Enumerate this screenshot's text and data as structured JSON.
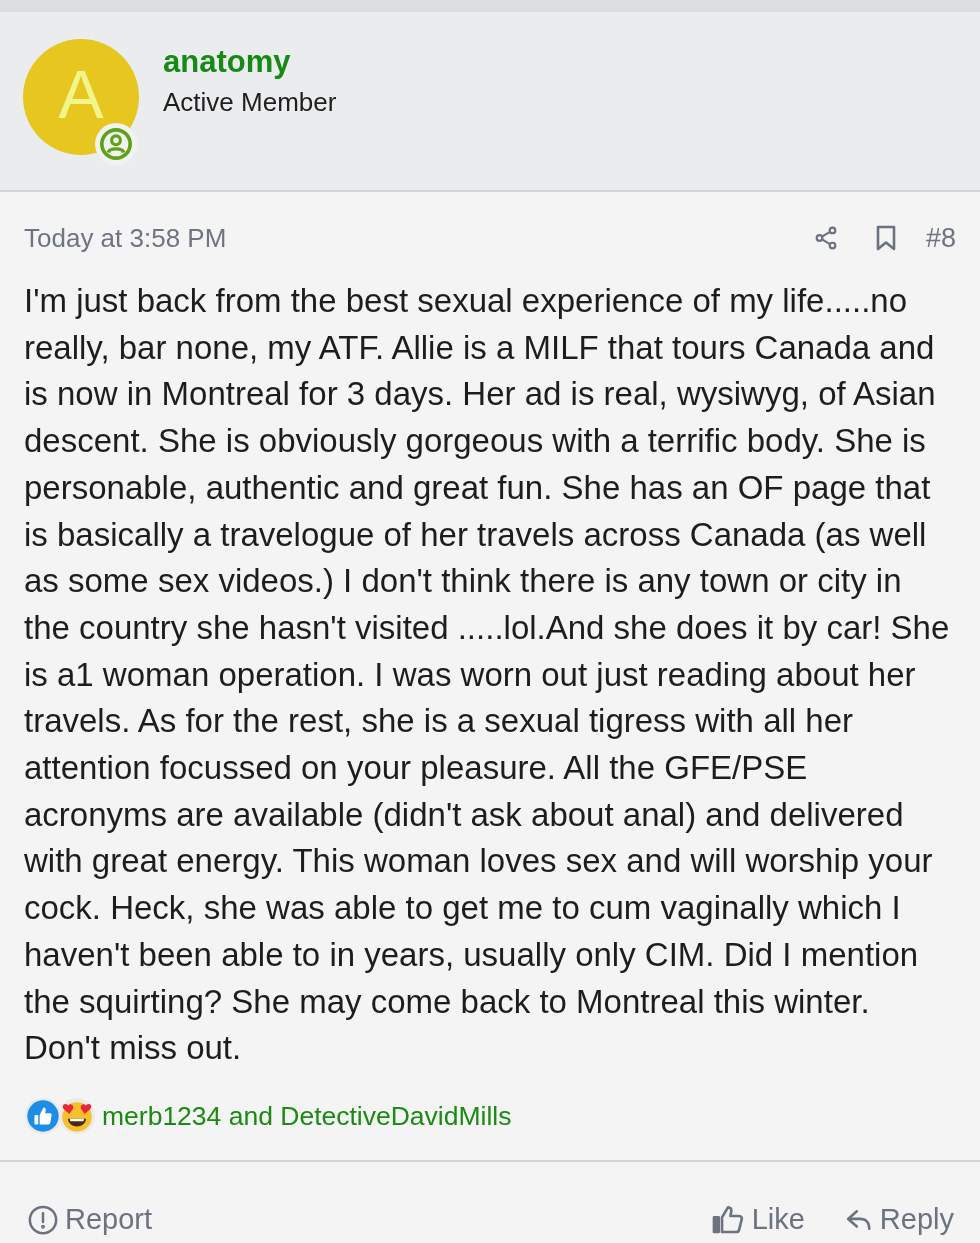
{
  "author": {
    "avatar_letter": "A",
    "name": "anatomy",
    "title": "Active Member"
  },
  "post": {
    "time": "Today at 3:58 PM",
    "number": "#8",
    "body": "I'm just back from the best sexual experience of my life.....no really, bar none, my ATF. Allie is a MILF that tours Canada and is now in Montreal for 3 days. Her ad is real, wysiwyg, of Asian descent. She is obviously gorgeous with a terrific body. She is personable, authentic and great fun. She has an OF page that is basically a travelogue of her travels across Canada (as well as some sex videos.) I don't think there is any town or city in the country she hasn't visited .....lol.And she does it by car! She is a1 woman operation. I was worn out just reading about her travels. As for the rest, she is a sexual tigress with all her attention focussed on your pleasure. All the GFE/PSE acronyms are available (didn't ask about anal) and delivered with great energy. This woman loves sex and will worship your cock. Heck, she was able to get me to cum vaginally which I haven't been able to in years, usually only CIM. Did I mention the squirting? She may come back to Montreal this winter. Don't miss out."
  },
  "reactions": {
    "text": "merb1234 and DetectiveDavidMills"
  },
  "footer": {
    "left": [
      {
        "kind": "report",
        "label": "Report"
      }
    ],
    "right": [
      {
        "kind": "like",
        "label": "Like"
      },
      {
        "kind": "reply",
        "label": "Reply"
      }
    ]
  }
}
